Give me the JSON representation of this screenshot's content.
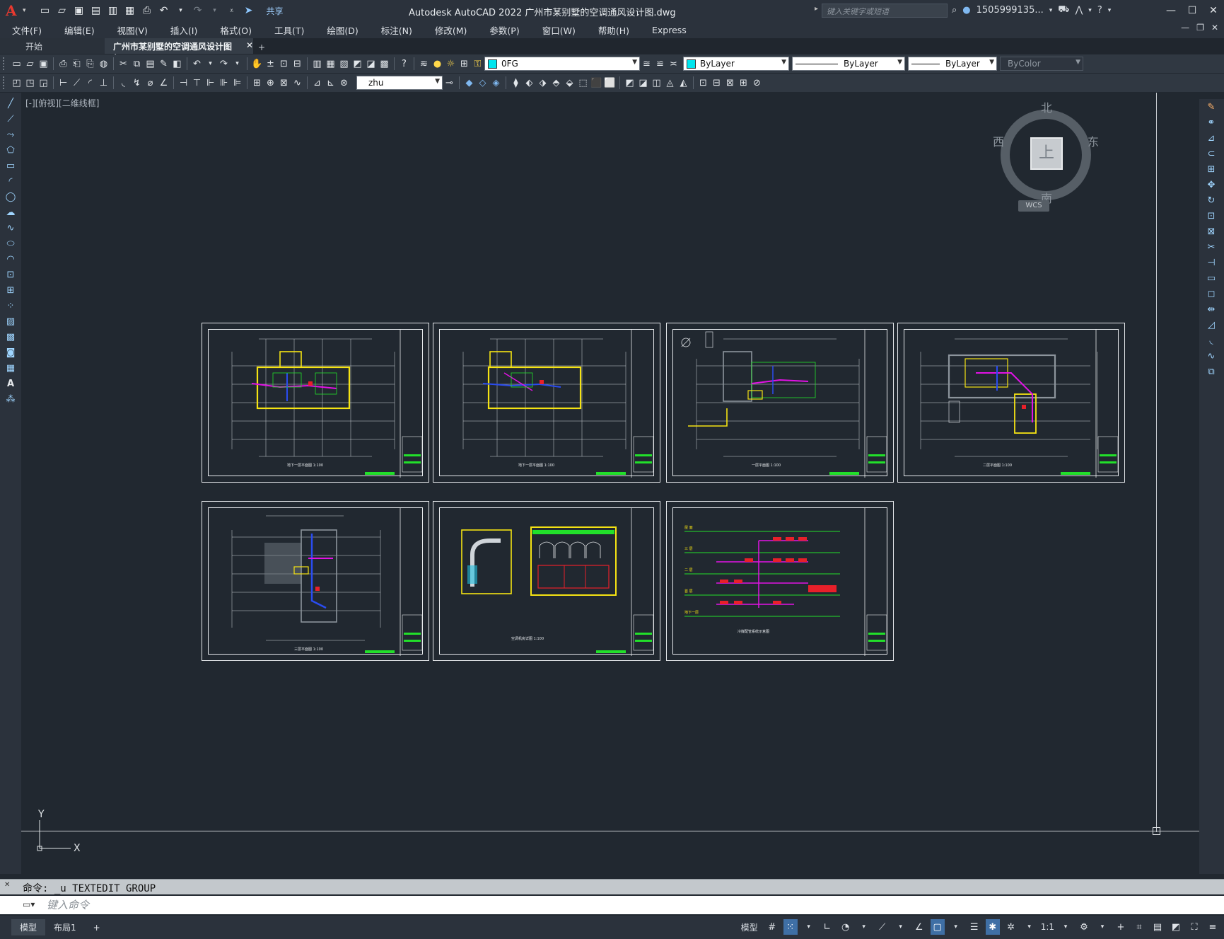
{
  "window": {
    "title": "Autodesk AutoCAD 2022   广州市某别墅的空调通风设计图.dwg",
    "share_label": "共享",
    "search_placeholder": "键入关键字或短语",
    "user": "1505999135...",
    "minimize": "—",
    "maximize": "☐",
    "close": "✕"
  },
  "menu": [
    "文件(F)",
    "编辑(E)",
    "视图(V)",
    "插入(I)",
    "格式(O)",
    "工具(T)",
    "绘图(D)",
    "标注(N)",
    "修改(M)",
    "参数(P)",
    "窗口(W)",
    "帮助(H)",
    "Express"
  ],
  "tabs": {
    "start": "开始",
    "active": "广州市某别墅的空调通风设计图*",
    "close": "✕",
    "add": "+"
  },
  "toolbar": {
    "layer": "0FG",
    "color": "ByLayer",
    "linetype": "ByLayer",
    "lineweight": "ByLayer",
    "plotstyle": "ByColor",
    "textstyle": "zhu",
    "layer_swatch_color": "#00e5ee"
  },
  "viewport": {
    "label": "[-][俯视][二维线框]",
    "compass": {
      "north": "北",
      "south": "南",
      "east": "东",
      "west": "西",
      "top": "上"
    },
    "wcs": "WCS",
    "ucs_x": "X",
    "ucs_y": "Y"
  },
  "command": {
    "history": "命令: _u TEXTEDIT GROUP",
    "placeholder": "键入命令"
  },
  "status": {
    "model_tab": "模型",
    "layout_tab": "布局1",
    "add_tab": "+",
    "model_label": "模型",
    "scale": "1:1"
  },
  "colors": {
    "background": "#212830",
    "accent_yellow": "#f5e313",
    "accent_magenta": "#e312e6",
    "accent_green": "#22e02a",
    "accent_red": "#e8202a",
    "accent_blue": "#2a4cf0"
  }
}
